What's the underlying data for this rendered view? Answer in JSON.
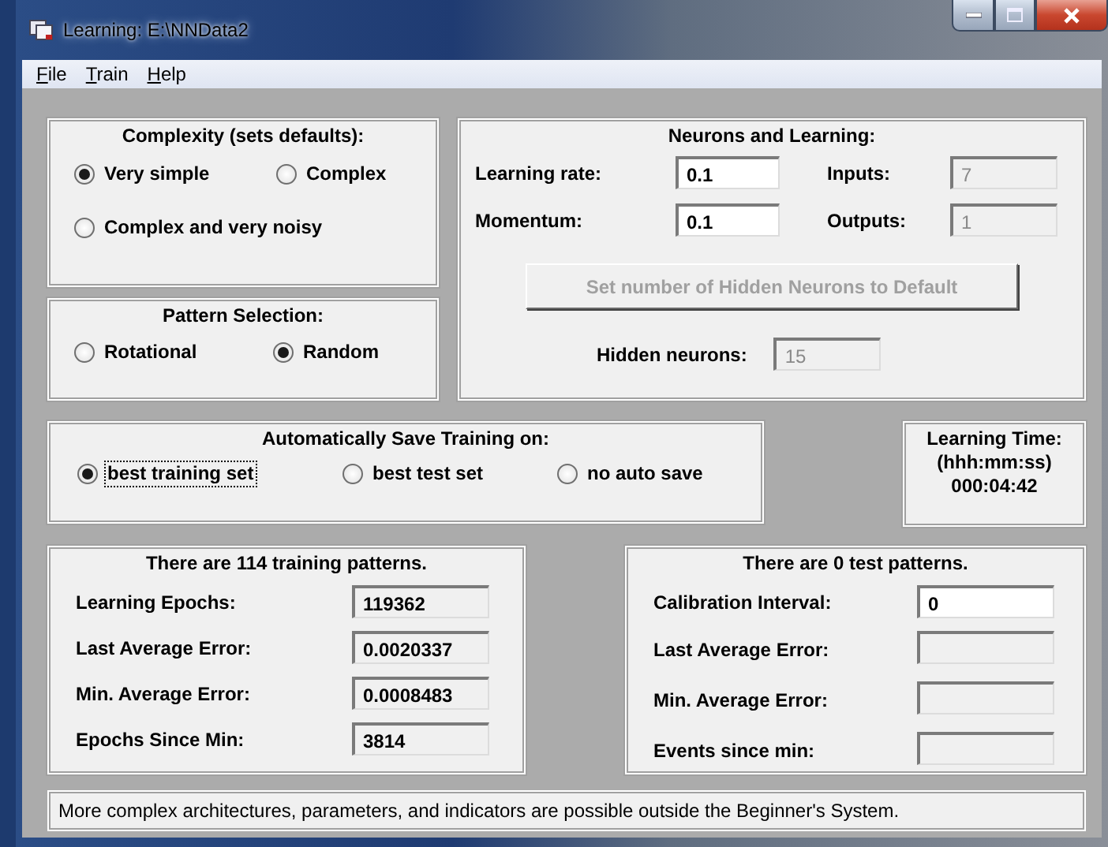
{
  "window": {
    "title": "Learning: E:\\NNData2"
  },
  "menu": [
    {
      "label": "File"
    },
    {
      "label": "Train"
    },
    {
      "label": "Help"
    }
  ],
  "complexity": {
    "title": "Complexity (sets defaults):",
    "options": [
      {
        "label": "Very simple",
        "selected": true
      },
      {
        "label": "Complex",
        "selected": false
      },
      {
        "label": "Complex and very noisy",
        "selected": false
      }
    ]
  },
  "pattern_selection": {
    "title": "Pattern Selection:",
    "options": [
      {
        "label": "Rotational",
        "selected": false
      },
      {
        "label": "Random",
        "selected": true
      }
    ]
  },
  "neurons": {
    "title": "Neurons and Learning:",
    "fields": [
      {
        "label": "Learning rate:",
        "value": "0.1",
        "kind": "editable"
      },
      {
        "label": "Inputs:",
        "value": "7",
        "kind": "disabled"
      },
      {
        "label": "Momentum:",
        "value": "0.1",
        "kind": "editable"
      },
      {
        "label": "Outputs:",
        "value": "1",
        "kind": "disabled"
      }
    ],
    "button": {
      "label": "Set number of  Hidden Neurons to Default",
      "disabled": true
    },
    "hidden": {
      "label": "Hidden neurons:",
      "value": "15",
      "kind": "disabled"
    }
  },
  "auto_save": {
    "title": "Automatically Save Training on:",
    "options": [
      {
        "label": "best training set",
        "selected": true,
        "focused": true
      },
      {
        "label": "best test set",
        "selected": false,
        "focused": false
      },
      {
        "label": "no auto save",
        "selected": false,
        "focused": false
      }
    ]
  },
  "learning_time": {
    "title": "Learning Time:",
    "format": "(hhh:mm:ss)",
    "value": "000:04:42"
  },
  "training": {
    "title": "There are 114 training patterns.",
    "rows": [
      {
        "label": "Learning Epochs:",
        "value": "119362",
        "kind": "readonly"
      },
      {
        "label": "Last Average Error:",
        "value": "0.0020337",
        "kind": "readonly"
      },
      {
        "label": "Min. Average Error:",
        "value": "0.0008483",
        "kind": "readonly"
      },
      {
        "label": "Epochs Since Min:",
        "value": "3814",
        "kind": "readonly"
      }
    ]
  },
  "test": {
    "title": "There are 0 test patterns.",
    "rows": [
      {
        "label": "Calibration Interval:",
        "value": "0",
        "kind": "editable"
      },
      {
        "label": "Last Average Error:",
        "kind": "readonly"
      },
      {
        "label": "Min. Average Error:",
        "kind": "readonly"
      },
      {
        "label": "Events since min:",
        "kind": "readonly"
      }
    ]
  },
  "status_bar": {
    "text": "More complex architectures, parameters, and indicators are possible outside the Beginner's System."
  }
}
